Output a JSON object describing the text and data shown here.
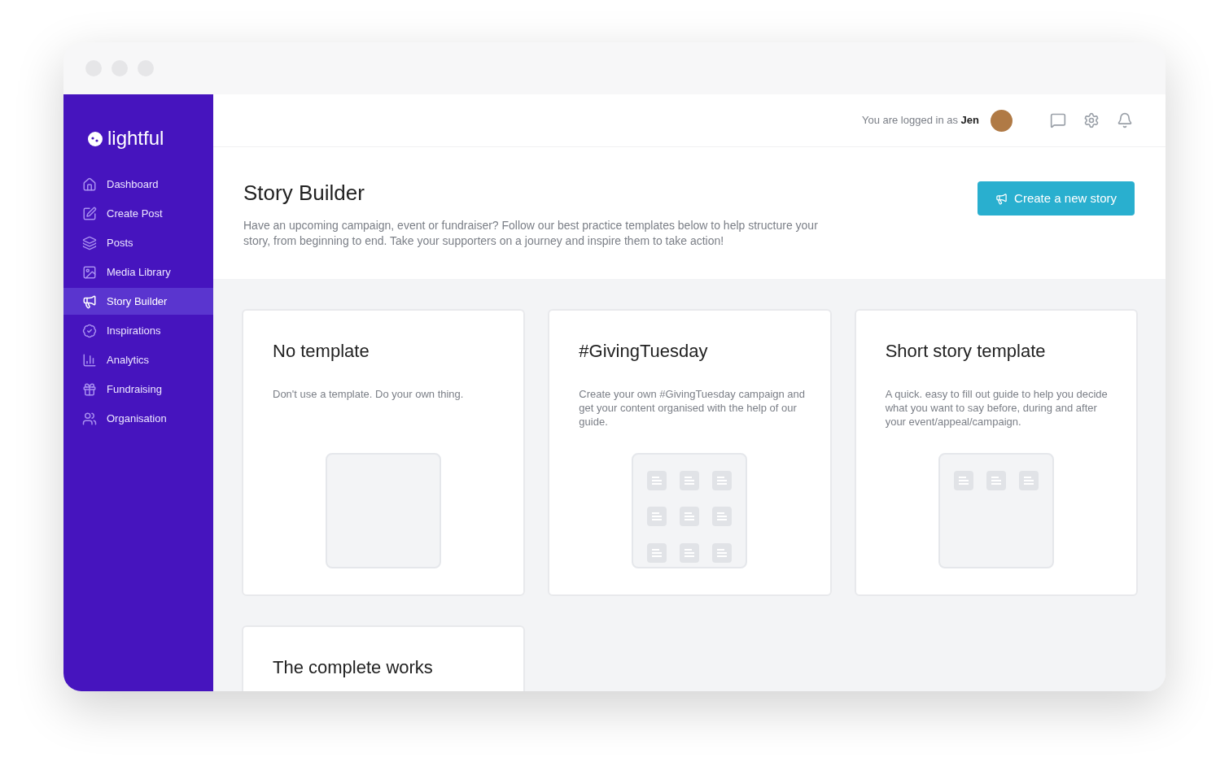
{
  "sidebar": {
    "logo": "lightful",
    "items": [
      {
        "label": "Dashboard",
        "kind": "home",
        "selected": false
      },
      {
        "label": "Create Post",
        "kind": "edit",
        "selected": false
      },
      {
        "label": "Posts",
        "kind": "layers",
        "selected": false
      },
      {
        "label": "Media Library",
        "kind": "image",
        "selected": false
      },
      {
        "label": "Story Builder",
        "kind": "megaphone",
        "selected": true
      },
      {
        "label": "Inspirations",
        "kind": "badge",
        "selected": false
      },
      {
        "label": "Analytics",
        "kind": "chart",
        "selected": false
      },
      {
        "label": "Fundraising",
        "kind": "gift",
        "selected": false
      },
      {
        "label": "Organisation",
        "kind": "users",
        "selected": false
      }
    ]
  },
  "header": {
    "login_text": "You are logged in as **Jen**"
  },
  "page": {
    "title": "Story Builder",
    "description": "Have an upcoming campaign, event or fundraiser? Follow our best practice templates below to help structure your story, from beginning to end. Take your supporters on a journey and inspire them to take action!",
    "create_button": "Create a new story"
  },
  "templates": [
    {
      "title": "No template",
      "description": "Don't use a template. Do your own thing.",
      "kind": "empty"
    },
    {
      "title": "#GivingTuesday",
      "description": "Create your own #GivingTuesday campaign and get your content organised with the help of our guide.",
      "kind": "grid"
    },
    {
      "title": "Short story template",
      "description": "A quick. easy to fill out guide to help you decide what you want to say before, during and after your event/appeal/campaign.",
      "kind": "row"
    },
    {
      "title": "The complete works",
      "kind": "cut"
    }
  ]
}
